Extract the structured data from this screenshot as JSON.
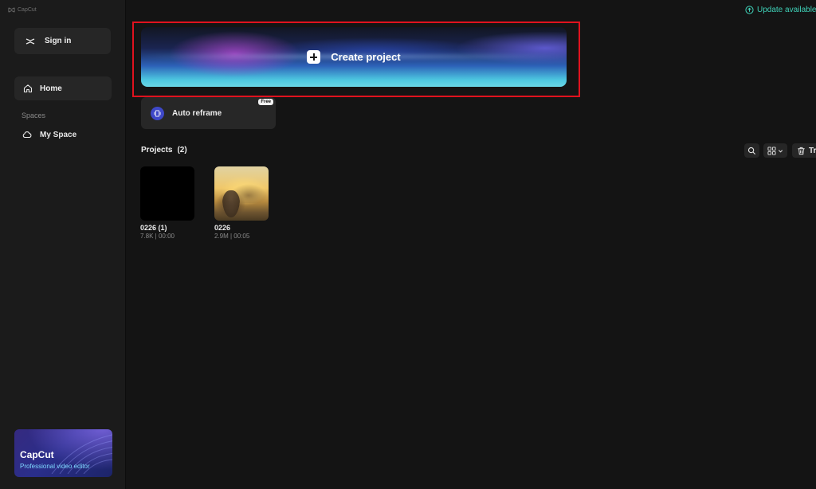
{
  "app": {
    "title": "CapCut"
  },
  "sidebar": {
    "sign_in_label": "Sign in",
    "home_label": "Home",
    "spaces_heading": "Spaces",
    "my_space_label": "My Space",
    "promo": {
      "title": "CapCut",
      "subtitle": "Professional video editor"
    }
  },
  "topbar": {
    "update_label": "Update available"
  },
  "main": {
    "create_label": "Create project",
    "auto_reframe": {
      "label": "Auto reframe",
      "badge": "Free"
    },
    "projects": {
      "title": "Projects",
      "count": "(2)",
      "trash_label": "Tr",
      "items": [
        {
          "name": "0226 (1)",
          "meta": "7.8K | 00:00"
        },
        {
          "name": "0226",
          "meta": "2.9M | 00:05"
        }
      ]
    }
  },
  "colors": {
    "background": "#141414",
    "sidebar": "#1b1b1b",
    "accent_update": "#3fd1b8",
    "highlight_frame": "#e0121e"
  }
}
